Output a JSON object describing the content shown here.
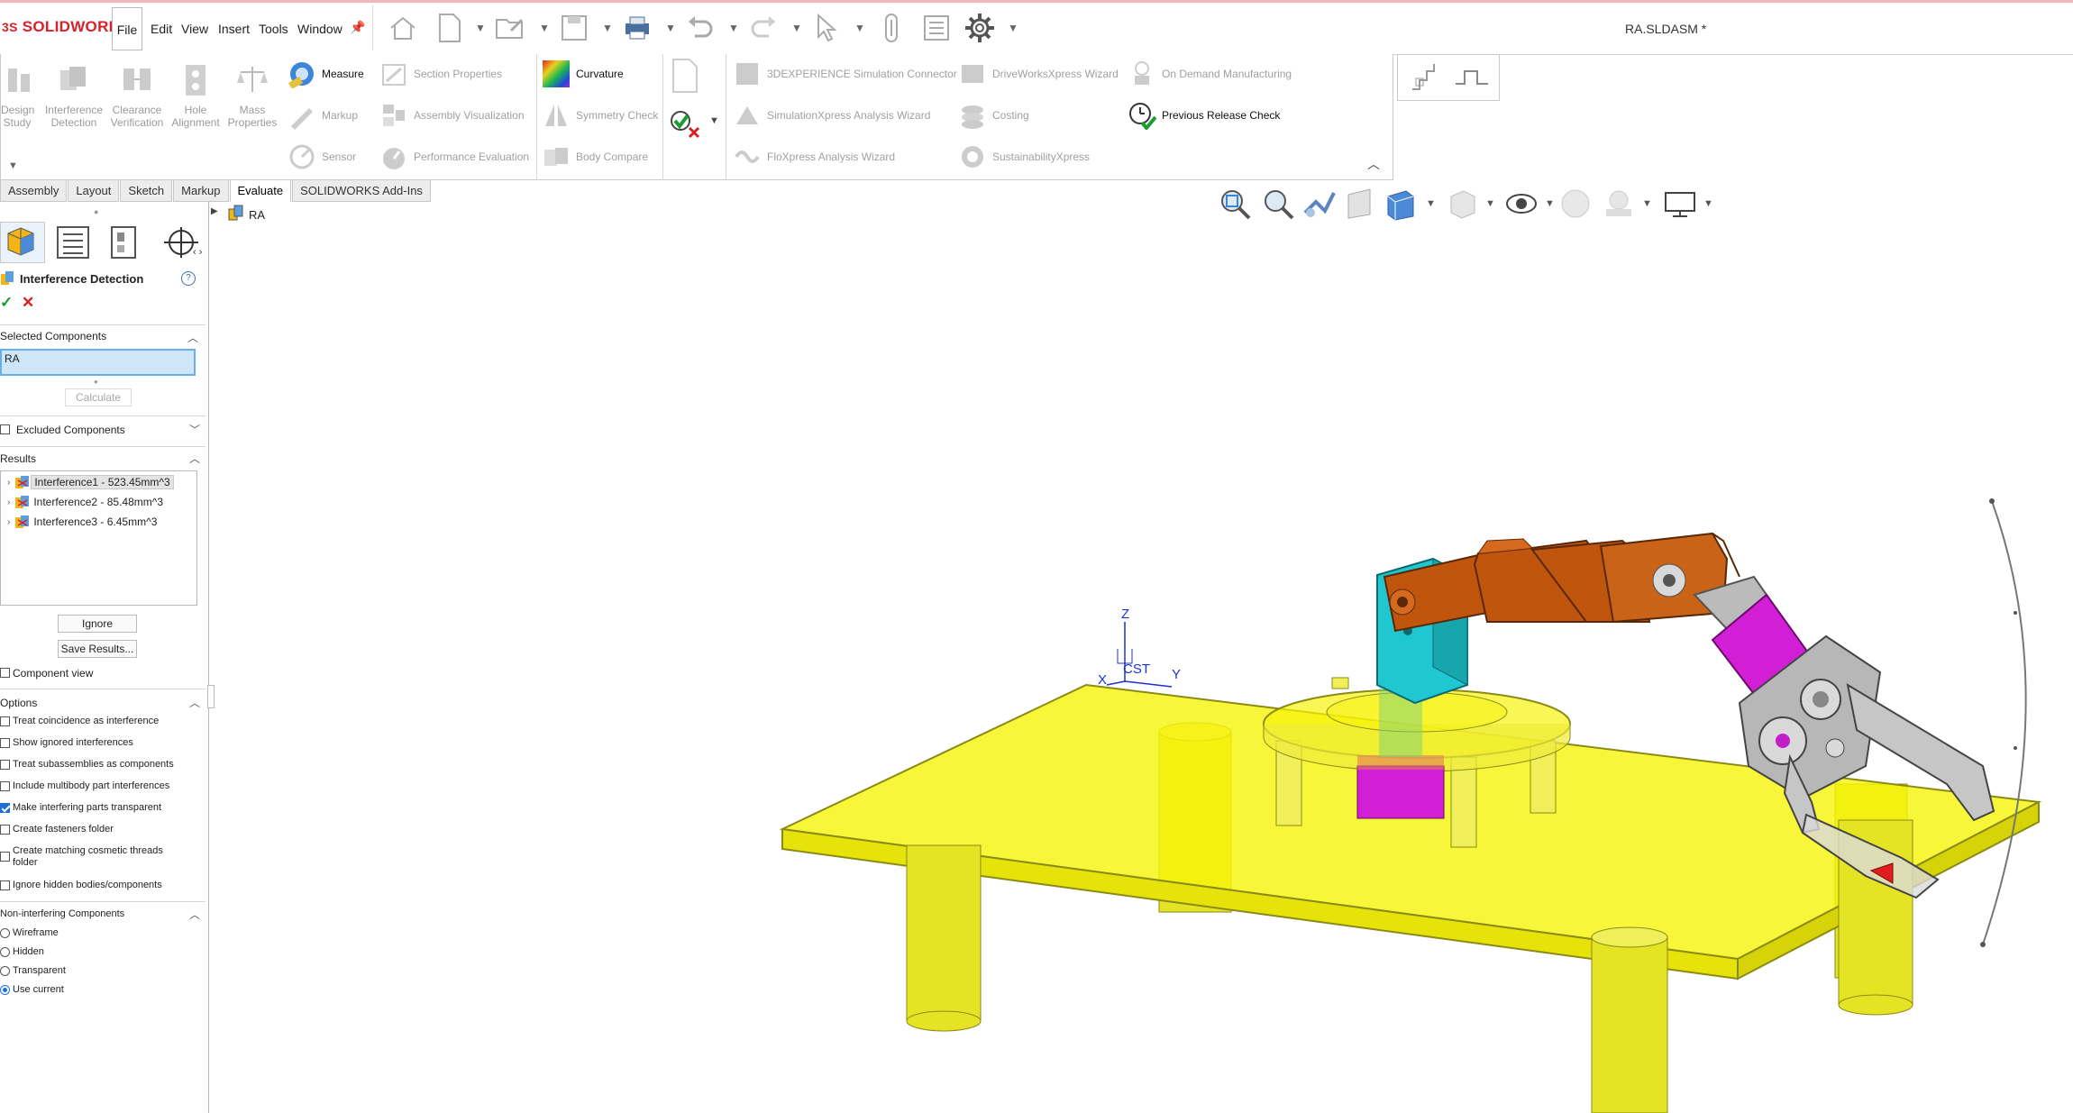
{
  "app": {
    "logo": "SOLIDWORKS",
    "doc_title": "RA.SLDASM *"
  },
  "menu": [
    "File",
    "Edit",
    "View",
    "Insert",
    "Tools",
    "Window"
  ],
  "ribbon": {
    "big_tools": [
      {
        "label": "Design Study",
        "lines": [
          "Design",
          "Study"
        ]
      },
      {
        "label": "Interference Detection",
        "lines": [
          "Interference",
          "Detection"
        ]
      },
      {
        "label": "Clearance Verification",
        "lines": [
          "Clearance",
          "Verification"
        ]
      },
      {
        "label": "Hole Alignment",
        "lines": [
          "Hole",
          "Alignment"
        ]
      },
      {
        "label": "Mass Properties",
        "lines": [
          "Mass",
          "Properties"
        ]
      }
    ],
    "col1": [
      "Measure",
      "Markup",
      "Sensor"
    ],
    "col2": [
      "Section Properties",
      "Assembly Visualization",
      "Performance Evaluation"
    ],
    "col3": [
      "Curvature",
      "Symmetry Check",
      "Body Compare"
    ],
    "col4": [
      "3DEXPERIENCE Simulation Connector",
      "SimulationXpress Analysis Wizard",
      "FloXpress Analysis Wizard"
    ],
    "col5": [
      "DriveWorksXpress Wizard",
      "Costing",
      "SustainabilityXpress"
    ],
    "col6": [
      "On Demand Manufacturing",
      "Previous Release Check"
    ]
  },
  "tabs": [
    "Assembly",
    "Layout",
    "Sketch",
    "Markup",
    "Evaluate",
    "SOLIDWORKS Add-Ins"
  ],
  "active_tab": "Evaluate",
  "panel": {
    "title": "Interference Detection",
    "selected_components_header": "Selected Components",
    "selected_value": "RA",
    "calculate": "Calculate",
    "excluded_header": "Excluded Components",
    "results_header": "Results",
    "results": [
      "Interference1 - 523.45mm^3",
      "Interference2 - 85.48mm^3",
      "Interference3 - 6.45mm^3"
    ],
    "ignore": "Ignore",
    "save_results": "Save Results...",
    "component_view": "Component view",
    "options_header": "Options",
    "options": [
      {
        "label": "Treat coincidence as interference",
        "checked": false
      },
      {
        "label": "Show ignored interferences",
        "checked": false
      },
      {
        "label": "Treat subassemblies as components",
        "checked": false
      },
      {
        "label": "Include multibody part interferences",
        "checked": false
      },
      {
        "label": "Make interfering parts transparent",
        "checked": true
      },
      {
        "label": "Create fasteners folder",
        "checked": false
      },
      {
        "label": "Create matching cosmetic threads folder",
        "checked": false
      },
      {
        "label": "Ignore hidden bodies/components",
        "checked": false
      }
    ],
    "non_interfering_header": "Non-interfering Components",
    "display_modes": [
      {
        "label": "Wireframe",
        "selected": false
      },
      {
        "label": "Hidden",
        "selected": false
      },
      {
        "label": "Transparent",
        "selected": false
      },
      {
        "label": "Use current",
        "selected": true
      }
    ]
  },
  "tree": {
    "root": "RA"
  },
  "triad": {
    "z": "Z",
    "x": "X",
    "y": "Y",
    "cs": "CST"
  },
  "colors": {
    "accent": "#1e6fd9",
    "table": "#f7f40c",
    "arm": "#c0560e",
    "servo": "#1fc7d1",
    "magenta": "#d21fd6"
  }
}
